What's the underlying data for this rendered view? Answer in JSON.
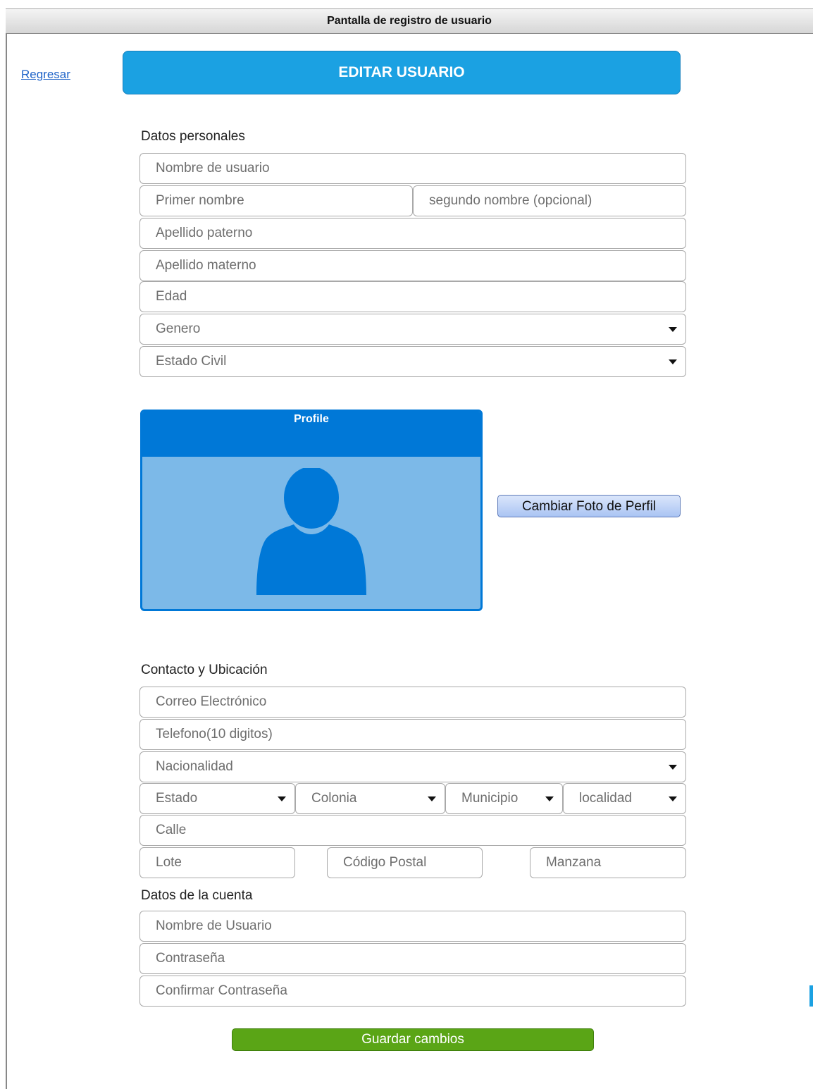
{
  "window": {
    "title": "Pantalla de registro de usuario"
  },
  "nav": {
    "back_label": "Regresar"
  },
  "header": {
    "title": "EDITAR USUARIO"
  },
  "personal": {
    "section_title": "Datos personales",
    "username_placeholder": "Nombre de usuario",
    "first_name_placeholder": "Primer nombre",
    "second_name_placeholder": "segundo nombre (opcional)",
    "paternal_surname_placeholder": "Apellido paterno",
    "maternal_surname_placeholder": "Apellido materno",
    "age_placeholder": "Edad",
    "gender_select": "Genero",
    "marital_status_select": "Estado Civil"
  },
  "profile": {
    "card_title": "Profile",
    "avatar_icon": "user-silhouette-icon",
    "change_photo_label": "Cambiar Foto de Perfil"
  },
  "contact": {
    "section_title": "Contacto y Ubicación",
    "email_placeholder": "Correo Electrónico",
    "phone_placeholder": "Telefono(10 digitos)",
    "nationality_select": "Nacionalidad",
    "state_select": "Estado",
    "colony_select": "Colonia",
    "municipality_select": "Municipio",
    "locality_select": "localidad",
    "street_placeholder": "Calle",
    "lot_placeholder": "Lote",
    "postal_code_placeholder": "Código Postal",
    "block_placeholder": "Manzana"
  },
  "account": {
    "section_title": "Datos de la cuenta",
    "username_placeholder": "Nombre de Usuario",
    "password_placeholder": "Contraseña",
    "confirm_password_placeholder": "Confirmar Contraseña"
  },
  "actions": {
    "save_label": "Guardar cambios"
  },
  "colors": {
    "accent": "#1ba1e2",
    "profile_blue": "#0078d7",
    "profile_light": "#7cb9e8",
    "save_green": "#5aa516",
    "link": "#1e63c8"
  }
}
